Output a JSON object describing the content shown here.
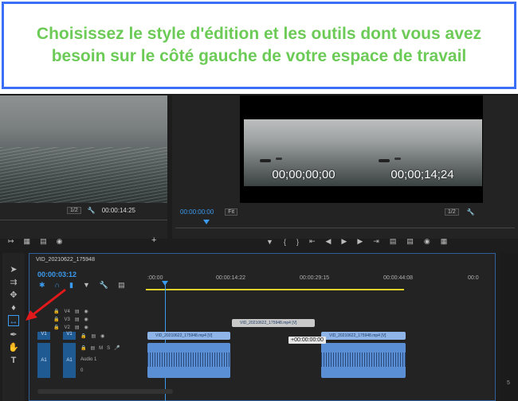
{
  "caption": "Choisissez le style d'édition et les outils dont vous avez besoin sur le côté gauche de votre espace de travail",
  "source": {
    "zoom": "1/2",
    "timecode": "00:00:14:25"
  },
  "program": {
    "timecode": "00:00:00:00",
    "fit": "Fit",
    "zoom": "1/2",
    "still1_tc": "00;00;00;00",
    "still2_tc": "00;00;14;24"
  },
  "timeline": {
    "tab": "VID_20210622_175948",
    "timecode": "00:00:03:12",
    "ruler": [
      ":00:00",
      "00:00:14:22",
      "00:00:29:15",
      "00:00:44:08",
      "00:0"
    ],
    "tracks_video": [
      "V4",
      "V3",
      "V2",
      "V1"
    ],
    "tracks_audio": [
      "A1"
    ],
    "audio_label": "Audio 1",
    "audio_value": "0",
    "patch_v": "V1",
    "patch_a": "A1",
    "clip_top": "VID_20210622_175948.mp4 [V]",
    "clip_v1a": "VID_20210622_175948.mp4 [V]",
    "clip_v1b": "VID_20210622_175948.mp4 [V]",
    "tooltip": "+00:00:00:00",
    "track_m": "M",
    "track_s": "S"
  },
  "right_panel_value": "5"
}
